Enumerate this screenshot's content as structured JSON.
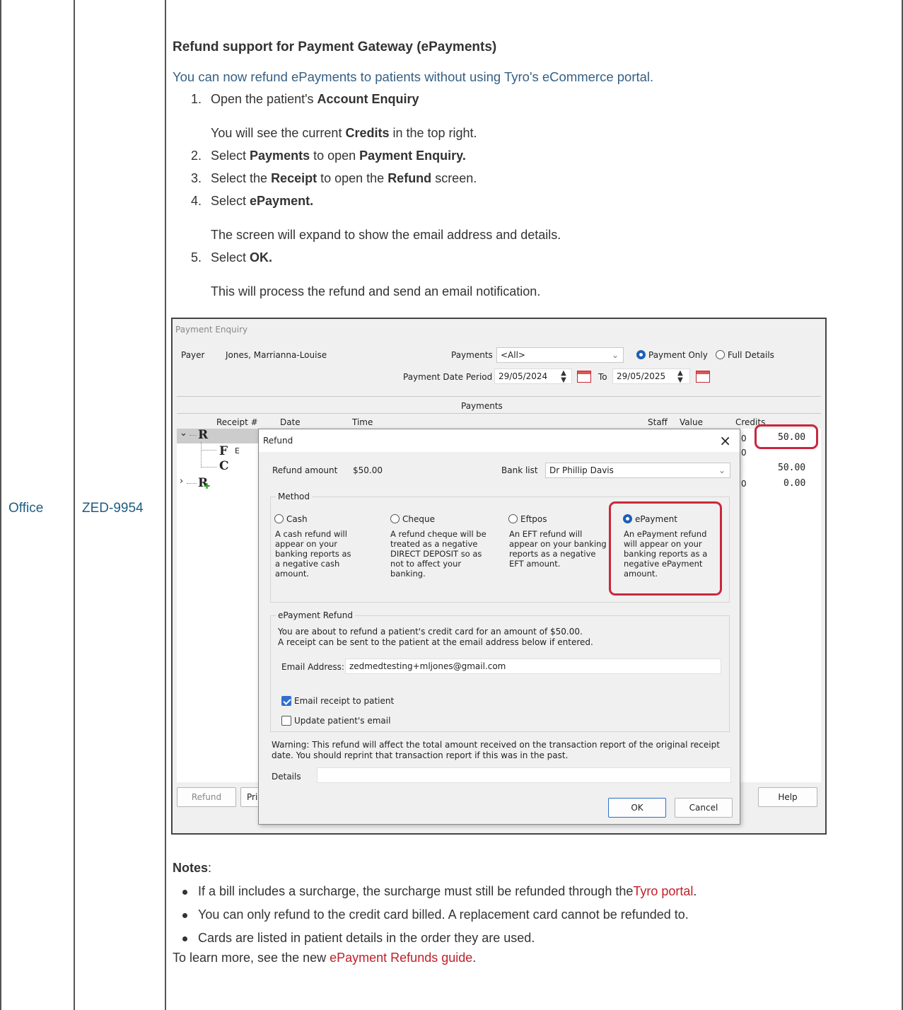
{
  "table": {
    "col1": "Office",
    "col2": "ZED-9954"
  },
  "article": {
    "heading": "Refund support for Payment Gateway (ePayments)",
    "intro": "You can now refund ePayments to patients without using Tyro's eCommerce portal.",
    "steps": [
      {
        "n": "1.",
        "a": "Open the patient's ",
        "b": "Account Enquiry",
        "c": "",
        "d": "",
        "e": ""
      },
      {
        "n": "2.",
        "a": "Select ",
        "b": "Payments",
        "c": " to open ",
        "d": "Payment Enquiry.",
        "e": ""
      },
      {
        "n": "3.",
        "a": "Select the ",
        "b": "Receipt",
        "c": " to open the ",
        "d": "Refund",
        "e": " screen."
      },
      {
        "n": "4.",
        "a": "Select ",
        "b": "ePayment.",
        "c": "",
        "d": "",
        "e": ""
      },
      {
        "n": "5.",
        "a": "Select ",
        "b": "OK.",
        "c": "",
        "d": "",
        "e": ""
      }
    ],
    "step1_note_a": "You will see the current ",
    "step1_note_b": "Credits",
    "step1_note_c": " in the top right.",
    "step4_note": "The screen will expand to show the email address and details.",
    "step5_note": "This will process the refund and send an email notification.",
    "notes_title": "Notes",
    "notes_colon": ":",
    "notes": [
      {
        "text": "If a bill includes a surcharge, the surcharge must still be refunded through the",
        "link": "Tyro portal",
        "after": "."
      },
      {
        "text": "You can only refund to the credit card billed. A replacement card cannot be refunded to.",
        "link": "",
        "after": ""
      },
      {
        "text": "Cards are listed in patient details in the order they are used.",
        "link": "",
        "after": ""
      }
    ],
    "outro_text": "To learn more, see the new ",
    "outro_link": "ePayment Refunds guide",
    "outro_after": "."
  },
  "screenshot": {
    "window_title": "Payment Enquiry",
    "payer_label": "Payer",
    "payer_value": "Jones, Marrianna-Louise",
    "payments_label": "Payments",
    "payments_select": "<All>",
    "radio_payment_only": "Payment Only",
    "radio_full_details": "Full Details",
    "date_period_label": "Payment Date Period",
    "date_from": "29/05/2024",
    "to_label": "To",
    "date_to": "29/05/2025",
    "section_label": "Payments",
    "columns": [
      "Receipt #",
      "Date",
      "Time",
      "Staff",
      "Value",
      "Credits"
    ],
    "tree_nodes": [
      "R",
      "F",
      "C",
      "R"
    ],
    "tree_letter_partial": "E",
    "credit_values": [
      "50.00",
      "50.00",
      "0.00"
    ],
    "row_fragments": [
      "0",
      "0",
      "0"
    ],
    "bottom_buttons": {
      "refund": "Refund",
      "print": "Pri",
      "help": "Help"
    },
    "dialog": {
      "title": "Refund",
      "close": "×",
      "refund_amount_label": "Refund amount",
      "refund_amount_value": "$50.00",
      "bank_list_label": "Bank list",
      "bank_list_value": "Dr Phillip Davis",
      "method_label": "Method",
      "methods": [
        {
          "name": "Cash",
          "desc": "A cash refund will appear on your banking reports as a negative cash amount."
        },
        {
          "name": "Cheque",
          "desc": "A refund cheque will be treated as a negative DIRECT DEPOSIT so as not to affect your banking."
        },
        {
          "name": "Eftpos",
          "desc": "An EFT refund will appear on your banking reports as a negative EFT amount."
        },
        {
          "name": "ePayment",
          "desc": "An ePayment refund will appear on your banking reports as a negative ePayment amount."
        }
      ],
      "selected_method": "ePayment",
      "epayment_group_label": "ePayment Refund",
      "epayment_line1": "You are about to refund a patient's credit card for an amount of $50.00.",
      "epayment_line2": "A receipt can be sent to the patient at the email address below if entered.",
      "email_label": "Email Address:",
      "email_value": "zedmedtesting+mljones@gmail.com",
      "email_receipt_label": "Email receipt to patient",
      "email_receipt_checked": true,
      "update_email_label": "Update patient's email",
      "update_email_checked": false,
      "warning_line1": "Warning: This refund will affect the total amount received on the transaction report of the original receipt",
      "warning_line2": "date. You should reprint that transaction report if this was in the past.",
      "details_label": "Details",
      "details_value": "",
      "ok_label": "OK",
      "cancel_label": "Cancel"
    }
  },
  "colors": {
    "link": "#c0202a",
    "table_text": "#1f5d80",
    "highlight": "#c9273c",
    "radio_selected": "#1c5fb8"
  }
}
